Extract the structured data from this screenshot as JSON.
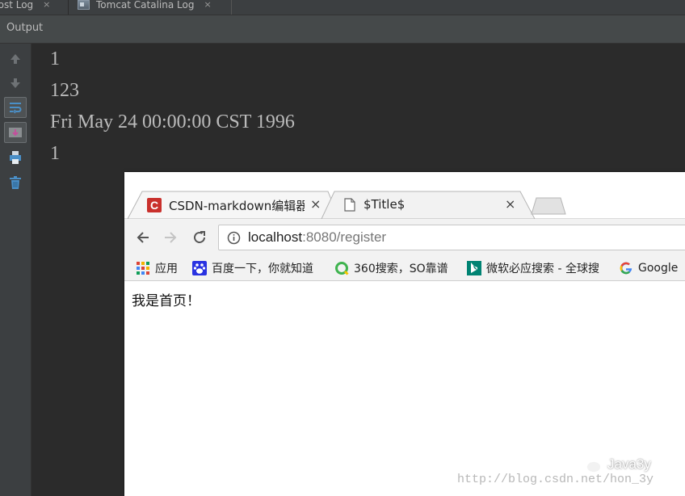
{
  "ide": {
    "tabs": [
      {
        "label": "host Log",
        "close": "×"
      },
      {
        "label": "Tomcat Catalina Log",
        "close": "×"
      }
    ],
    "panel_title": "Output",
    "console_lines": [
      "1",
      "123",
      "Fri May 24 00:00:00 CST 1996",
      "1"
    ],
    "tool_icons": [
      "up-arrow-icon",
      "down-arrow-icon",
      "soft-wrap-icon",
      "scroll-to-end-icon",
      "print-icon",
      "trash-icon"
    ]
  },
  "browser": {
    "tabs": [
      {
        "title": "CSDN-markdown编辑器",
        "close": "×"
      },
      {
        "title": "$Title$",
        "close": "×"
      }
    ],
    "address": {
      "host": "localhost",
      "rest": ":8080/register"
    },
    "bookmarks": [
      {
        "label": "应用",
        "icon": "apps-grid-icon"
      },
      {
        "label": "百度一下，你就知道",
        "icon": "baidu-paw-icon"
      },
      {
        "label": "360搜索，SO靠谱",
        "icon": "360-search-icon"
      },
      {
        "label": "微软必应搜索 - 全球搜",
        "icon": "bing-icon"
      },
      {
        "label": "Google",
        "icon": "google-icon"
      }
    ],
    "page_text": "我是首页！"
  },
  "watermarks": {
    "brand": "Java3y",
    "url": "http://blog.csdn.net/hon_3y"
  },
  "colors": {
    "ide_bg": "#2b2b2b",
    "ide_panel": "#3c3f41",
    "console_text": "#bbbbbb",
    "csdn_red": "#c9302c",
    "tool_blue": "#4a8fc7"
  }
}
